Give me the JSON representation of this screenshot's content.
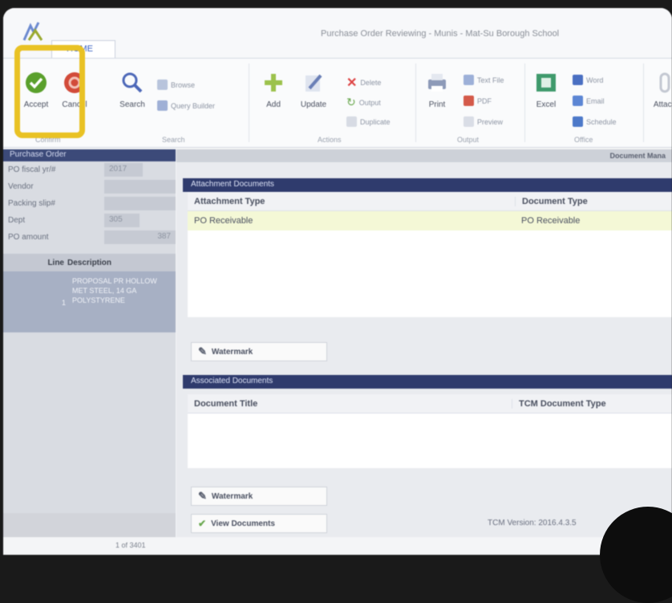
{
  "window": {
    "title": "Purchase Order Reviewing - Munis - Mat-Su Borough School",
    "tab_home": "HOME"
  },
  "ribbon": {
    "accept": "Accept",
    "cancel": "Cancel",
    "search": "Search",
    "browse": "Browse",
    "query_builder": "Query Builder",
    "add": "Add",
    "update": "Update",
    "delete": "Delete",
    "output": "Output",
    "duplicate": "Duplicate",
    "print": "Print",
    "text_file": "Text File",
    "pdf": "PDF",
    "preview": "Preview",
    "excel": "Excel",
    "word": "Word",
    "email": "Email",
    "schedule": "Schedule",
    "attach": "Attach",
    "groups": {
      "confirm": "Confirm",
      "search": "Search",
      "actions": "Actions",
      "output": "Output",
      "office": "Office"
    }
  },
  "left_panel": {
    "header": "Purchase Order",
    "fields": [
      {
        "label": "PO fiscal yr/#",
        "value": "2017"
      },
      {
        "label": "Vendor",
        "value": ""
      },
      {
        "label": "Packing slip#",
        "value": ""
      },
      {
        "label": "Dept",
        "value": "305"
      },
      {
        "label": "PO amount",
        "value": "387"
      }
    ],
    "line_col": "Line",
    "desc_col": "Description",
    "line_no": "1",
    "line_desc": "PROPOSAL PR HOLLOW MET STEEL, 14 GA POLYSTYRENE"
  },
  "main": {
    "top_label": "Document Mana",
    "attachment_section": "Attachment Documents",
    "attachment_cols": [
      "Attachment Type",
      "Document Type"
    ],
    "attachment_rows": [
      [
        "PO Receivable",
        "PO Receivable"
      ]
    ],
    "watermark": "Watermark",
    "associated_section": "Associated Documents",
    "associated_cols": [
      "Document Title",
      "TCM Document Type"
    ],
    "view_documents": "View Documents",
    "tcm_version": "TCM Version: 2016.4.3.5"
  },
  "status": {
    "record": "1 of 3401"
  },
  "colors": {
    "highlight": "#e9c224",
    "section_header": "#2f3b6d",
    "accept_green": "#5aa02c"
  }
}
